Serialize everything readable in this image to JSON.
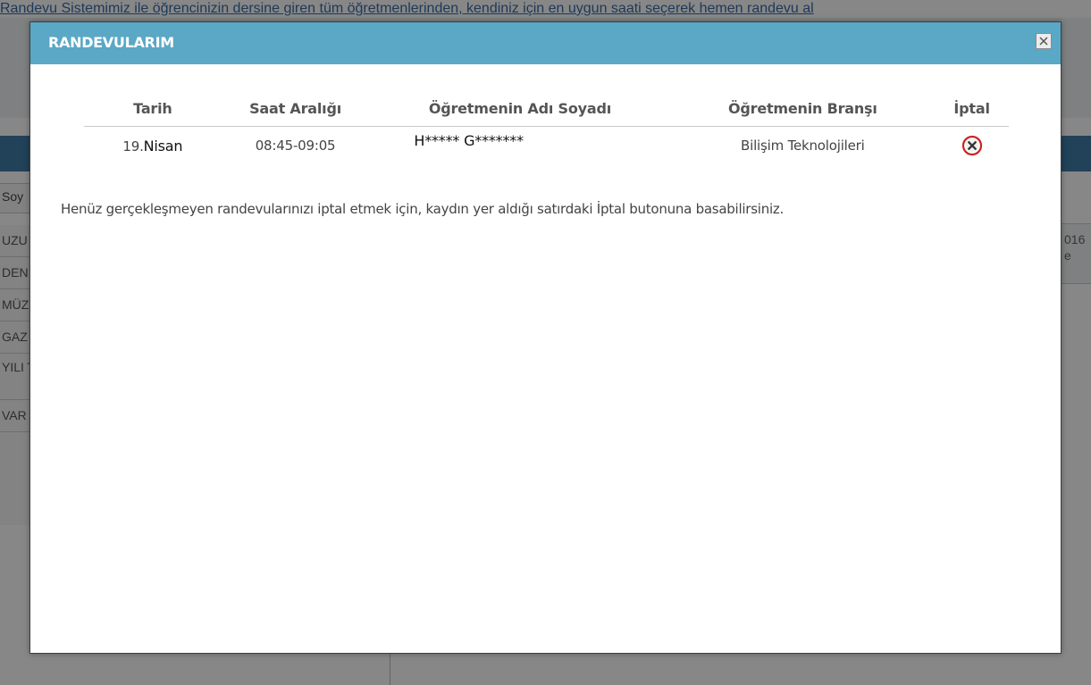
{
  "background": {
    "intro_text": "Randevu Sistemimiz ile öğrencinizin dersine giren tüm öğretmenlerinden, kendiniz için en uygun saati seçerek hemen randevu al",
    "soy_label": "Soy",
    "sidebar_items": [
      "UZU",
      "DEN",
      "MÜZ",
      "GAZ",
      "YILI TÜI",
      "VAR"
    ],
    "right_box_text": "016 e"
  },
  "modal": {
    "title": "RANDEVULARIM",
    "columns": {
      "tarih": "Tarih",
      "saat": "Saat Aralığı",
      "ogretmen": "Öğretmenin Adı Soyadı",
      "brans": "Öğretmenin Branşı",
      "iptal": "İptal"
    },
    "rows": [
      {
        "tarih_day": "19.",
        "tarih_month": "Nisan",
        "saat": "08:45-09:05",
        "ogretmen": "H***** G*******",
        "brans": "Bilişim Teknolojileri",
        "cancel_icon": "cancel-circle-icon"
      }
    ],
    "info_text": "Henüz gerçekleşmeyen randevularınızı iptal etmek için, kaydın yer aldığı satırdaki İptal butonuna basabilirsiniz."
  },
  "colors": {
    "header_bg": "#5aa8c5",
    "cancel_red": "#cc2222",
    "background_bar": "#3f7ea8"
  }
}
